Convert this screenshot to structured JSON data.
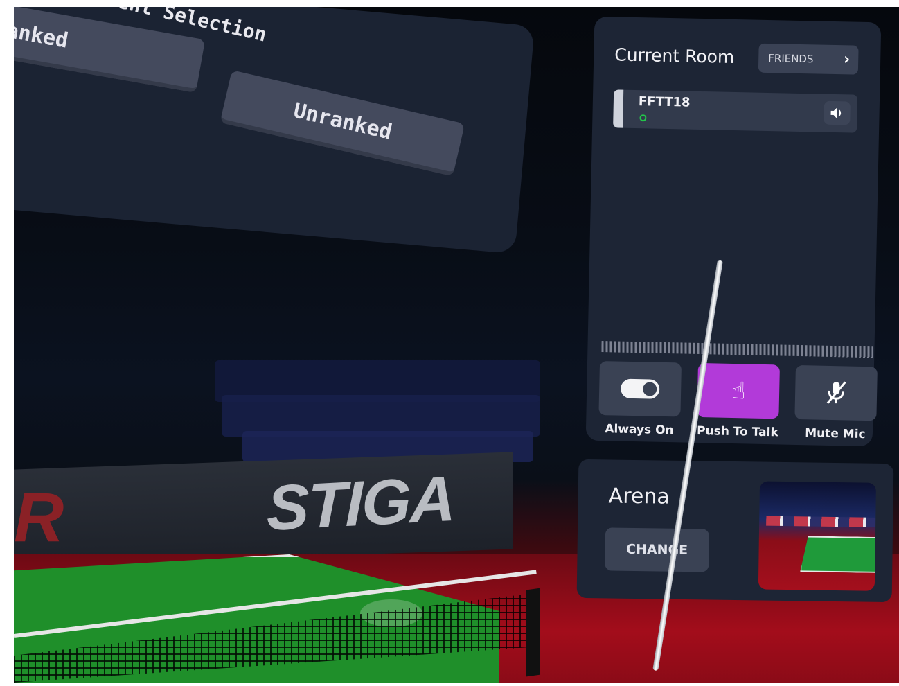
{
  "tournament_panel": {
    "title": "ent Selection",
    "buttons": [
      {
        "label": "anked"
      },
      {
        "label": "Unranked"
      }
    ]
  },
  "arena_scene": {
    "banner_left_logo": "R",
    "banner_logo": "STIGA"
  },
  "room": {
    "title": "Current Room",
    "friends_button": "FRIENDS",
    "members": [
      {
        "name": "FFTT18",
        "status_color": "#22c84a"
      }
    ],
    "voice_modes": [
      {
        "label": "Always On",
        "icon": "toggle-icon"
      },
      {
        "label": "Push To Talk",
        "icon": "tap-hand-icon",
        "selected": true,
        "accent": "#b23ad9"
      },
      {
        "label": "Mute Mic",
        "icon": "mic-off-icon"
      }
    ]
  },
  "arena": {
    "title": "Arena",
    "change_button": "CHANGE"
  }
}
